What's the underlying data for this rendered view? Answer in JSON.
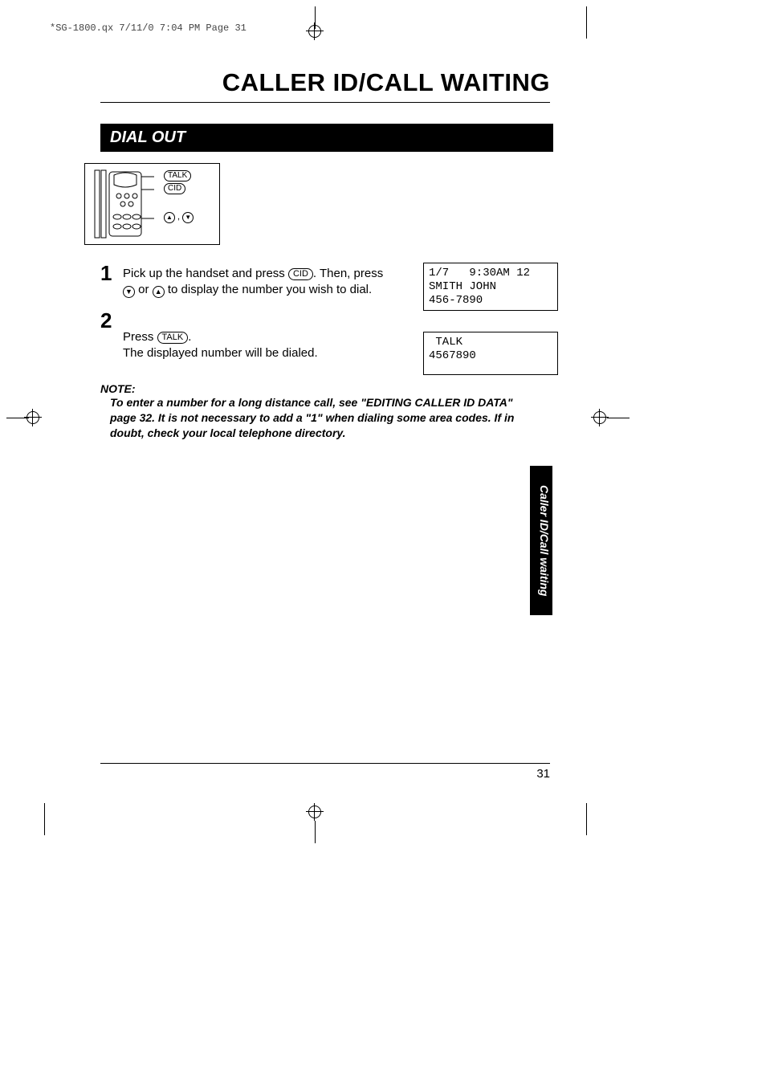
{
  "print_header": "*SG-1800.qx  7/11/0 7:04 PM  Page 31",
  "main_title": "CALLER ID/CALL WAITING",
  "section_title": "DIAL OUT",
  "diagram": {
    "talk": "TALK",
    "cid": "CID",
    "up": "▲",
    "down": "▼"
  },
  "steps": [
    {
      "num": "1",
      "pre": "Pick up the handset and press ",
      "btn1": "CID",
      "mid1": ".  Then, press  ",
      "arrow1": "▼",
      "mid2": " or ",
      "arrow2": "▲",
      "post": " to display the number you wish to dial."
    },
    {
      "num": "2",
      "pre": "Press ",
      "btn1": "TALK",
      "post": ".\nThe displayed number will be dialed."
    }
  ],
  "lcd1": "1/7   9:30AM 12\nSMITH JOHN\n456-7890",
  "lcd2": " TALK\n4567890",
  "note_label": "NOTE:",
  "note_body": "To enter a  number for a long distance call, see \"EDITING CALLER ID DATA\" page 32.  It is not necessary to add a \"1\" when dialing some area codes. If in doubt, check your local telephone directory.",
  "side_tab": "Caller ID/Call waiting",
  "page_number": "31"
}
